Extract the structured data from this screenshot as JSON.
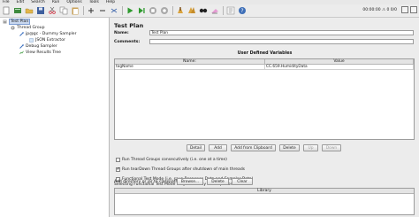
{
  "menu": [
    "File",
    "Edit",
    "Search",
    "Run",
    "Options",
    "Tools",
    "Help"
  ],
  "toolbar": {
    "icons": [
      "new-icon",
      "templates-icon",
      "open-icon",
      "save-icon",
      "cut-icon",
      "copy-icon",
      "paste-icon",
      "expand-icon",
      "collapse-icon",
      "toggle-icon",
      "start-icon",
      "start-no-pause-icon",
      "stop-icon",
      "shutdown-icon",
      "clear-icon",
      "clear-all-icon",
      "search-icon",
      "reset-search-icon",
      "function-helper-icon",
      "help-icon"
    ],
    "counter_text": "00:00:00  ⚠ 0  0/0"
  },
  "tree": {
    "items": [
      {
        "label": "Test Plan",
        "icon": "test-plan-icon"
      },
      {
        "label": "Thread Group",
        "icon": "thread-group-icon"
      },
      {
        "label": "jp@gc - Dummy Sampler",
        "icon": "sampler-icon"
      },
      {
        "label": "JSON Extractor",
        "icon": "extractor-icon"
      },
      {
        "label": "Debug Sampler",
        "icon": "debug-sampler-icon"
      },
      {
        "label": "View Results Tree",
        "icon": "listener-icon"
      }
    ]
  },
  "pane": {
    "title": "Test Plan",
    "name_label": "Name:",
    "name_value": "Test Plan",
    "comments_label": "Comments:",
    "comments_value": "",
    "udv_title": "User Defined Variables",
    "columns": [
      "Name:",
      "Value"
    ],
    "rows": [
      {
        "name": "tagName",
        "value": "CC.659.HumidityData"
      }
    ],
    "buttons": [
      "Detail",
      "Add",
      "Add from Clipboard",
      "Delete",
      "Up",
      "Down"
    ],
    "checkboxes": [
      {
        "label": "Run Thread Groups consecutively (i.e. one at a time)",
        "checked": false
      },
      {
        "label": "Run tearDown Thread Groups after shutdown of main threads",
        "checked": true
      },
      {
        "label": "Functional Test Mode (i.e. save Response Data and Sampler Data)",
        "checked": false
      }
    ],
    "functional_note": "Selecting Functional Test Mode may adversely affect performance.",
    "classpath_label": "Add directory or jar to classpath",
    "classpath_buttons": [
      "Browse...",
      "Delete",
      "Clear"
    ],
    "library_header": "Library"
  }
}
